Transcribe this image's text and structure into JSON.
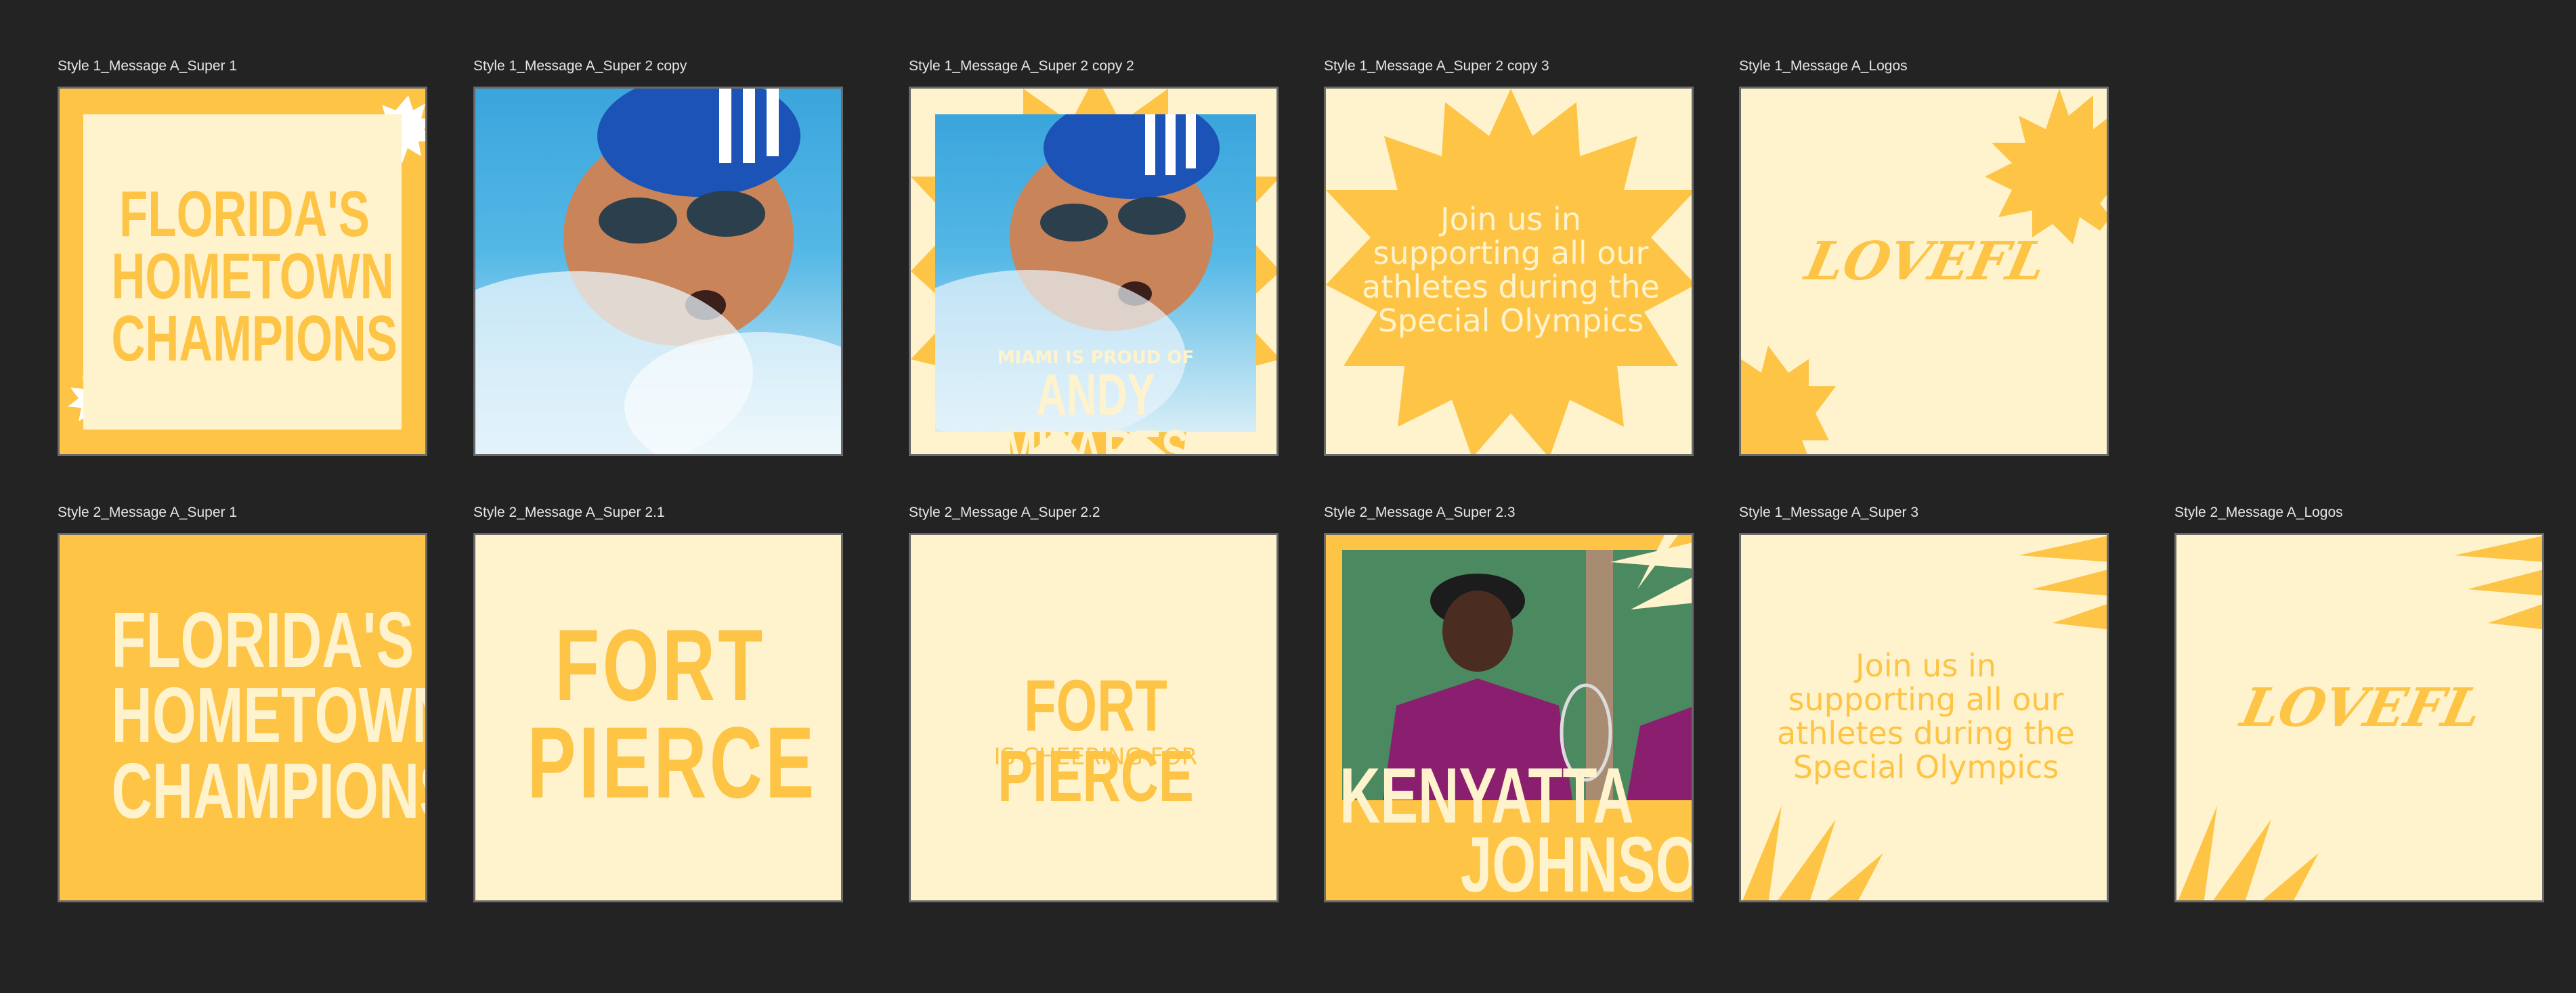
{
  "canvas": {
    "background": "#232323"
  },
  "colors": {
    "yellow": "#fdc445",
    "cream": "#fff3cd",
    "white": "#ffffff"
  },
  "artboards": [
    {
      "label": "Style 1_Message A_Super 1",
      "lines": [
        "FLORIDA'S",
        "HOMETOWN",
        "CHAMPIONS"
      ]
    },
    {
      "label": "Style 1_Message A_Super 2 copy",
      "photo": "swimmer-photo"
    },
    {
      "label": "Style 1_Message A_Super 2 copy 2",
      "kicker": "MIAMI IS PROUD OF",
      "name": "ANDY MIYARES"
    },
    {
      "label": "Style 1_Message A_Super 2 copy 3",
      "message": [
        "Join us in",
        "supporting all our",
        "athletes during the",
        "Special Olympics"
      ]
    },
    {
      "label": "Style 1_Message A_Logos",
      "logo": "LOVEFL"
    },
    {
      "label": "Style 2_Message A_Super 1",
      "lines": [
        "FLORIDA'S",
        "HOMETOWN",
        "CHAMPIONS"
      ]
    },
    {
      "label": "Style 2_Message A_Super 2.1",
      "lines": [
        "FORT",
        "PIERCE"
      ]
    },
    {
      "label": "Style 2_Message A_Super 2.2",
      "title": "FORT PIERCE",
      "subtitle": "IS CHEERING FOR"
    },
    {
      "label": "Style 2_Message A_Super 2.3",
      "name": [
        "KENYATTA",
        "JOHNSON"
      ]
    },
    {
      "label": "Style 1_Message A_Super 3",
      "message": [
        "Join us in",
        "supporting all our",
        "athletes during the",
        "Special Olympics"
      ]
    },
    {
      "label": "Style 2_Message A_Logos",
      "logo": "LOVEFL"
    }
  ]
}
